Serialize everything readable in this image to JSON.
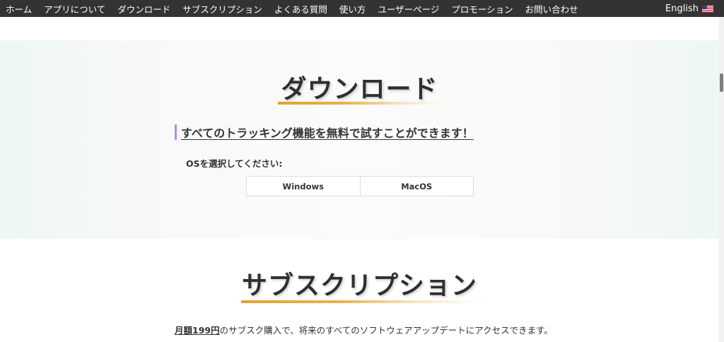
{
  "nav": {
    "items": [
      {
        "label": "ホーム"
      },
      {
        "label": "アプリについて"
      },
      {
        "label": "ダウンロード"
      },
      {
        "label": "サブスクリプション"
      },
      {
        "label": "よくある質問"
      },
      {
        "label": "使い方"
      },
      {
        "label": "ユーザーページ"
      },
      {
        "label": "プロモーション"
      },
      {
        "label": "お問い合わせ"
      }
    ],
    "language": {
      "label": "English",
      "flag_icon": "us-flag-icon"
    }
  },
  "download": {
    "title": "ダウンロード",
    "subheading": "すべてのトラッキング機能を無料で試すことができます！",
    "os_label": "OSを選択してください:",
    "os_options": [
      {
        "label": "Windows"
      },
      {
        "label": "MacOS"
      }
    ]
  },
  "subscription": {
    "title": "サブスクリプション",
    "price": "月額199円",
    "description_rest": "のサブスク購入で、将来のすべてのソフトウェアアップデートにアクセスできます。"
  },
  "colors": {
    "nav_background": "#333333",
    "accent_underline": "#e3a22f",
    "subheading_bar": "#b98be0"
  }
}
